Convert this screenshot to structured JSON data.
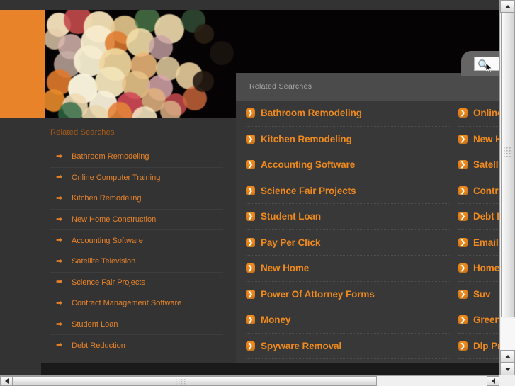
{
  "page": {
    "background_color": "#333333",
    "accent_color": "#e8832a",
    "banner_alt": "bokeh-lights-banner"
  },
  "left_panel": {
    "title": "Related Searches",
    "arrow_icon": "right-arrow-icon",
    "items": [
      "Bathroom Remodeling",
      "Online Computer Training",
      "Kitchen Remodeling",
      "New Home Construction",
      "Accounting Software",
      "Satellite Television",
      "Science Fair Projects",
      "Contract Management Software",
      "Student Loan",
      "Debt Reduction"
    ]
  },
  "search_widget": {
    "icon": "magnifier-icon",
    "cursor": "mouse-pointer-icon",
    "value": "",
    "placeholder": ""
  },
  "overlay": {
    "title": "Related Searches",
    "bullet_icon": "chevron-right-badge-icon",
    "left_column": [
      "Bathroom Remodeling",
      "Kitchen Remodeling",
      "Accounting Software",
      "Science Fair Projects",
      "Student Loan",
      "Pay Per Click",
      "New Home",
      "Power Of Attorney Forms",
      "Money",
      "Spyware Removal"
    ],
    "right_column": [
      "Online C",
      "New Ho",
      "Satellite",
      "Contrac",
      "Debt Re",
      "Email M",
      "Home I",
      "Suv",
      "Green C",
      "Dlp Pro"
    ]
  },
  "scrollbars": {
    "vertical": {
      "up_arrow": "scroll-up-icon",
      "down_arrow": "scroll-down-icon",
      "grip": "scroll-grip-icon"
    },
    "horizontal": {
      "left_arrow": "scroll-left-icon",
      "right_arrow": "scroll-right-icon",
      "grip": "scroll-grip-icon"
    }
  }
}
